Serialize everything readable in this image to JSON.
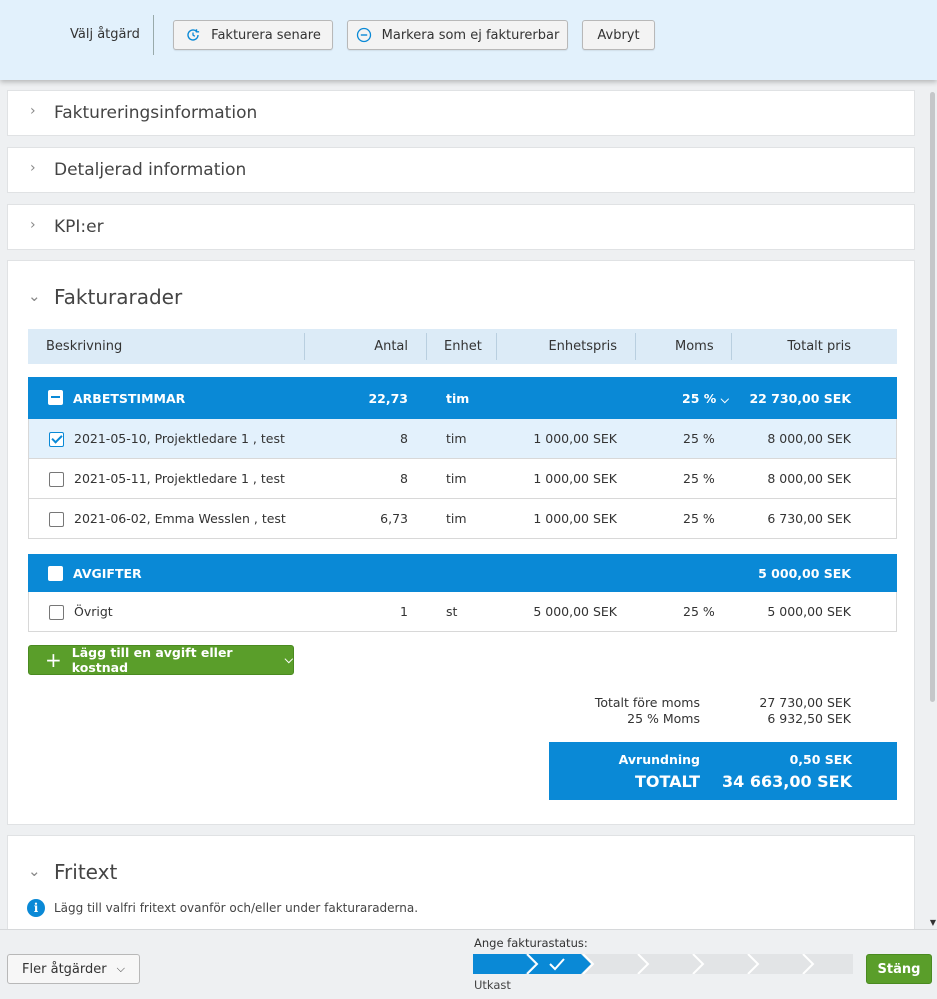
{
  "toolbar": {
    "label": "Välj åtgärd",
    "invoice_later": "Fakturera senare",
    "mark_not_billable": "Markera som ej fakturerbar",
    "cancel": "Avbryt"
  },
  "sections": {
    "billing_info": "Faktureringsinformation",
    "detailed_info": "Detaljerad information",
    "kpi": "KPI:er",
    "invoice_rows": "Fakturarader",
    "freetext": "Fritext"
  },
  "table": {
    "headers": {
      "description": "Beskrivning",
      "quantity": "Antal",
      "unit": "Enhet",
      "unit_price": "Enhetspris",
      "vat": "Moms",
      "total": "Totalt pris"
    },
    "groups": [
      {
        "name": "ARBETSTIMMAR",
        "quantity": "22,73",
        "unit": "tim",
        "vat": "25 %",
        "total": "22 730,00 SEK",
        "rows": [
          {
            "description": "2021-05-10, Projektledare 1 , test",
            "quantity": "8",
            "unit": "tim",
            "unit_price": "1 000,00 SEK",
            "vat": "25 %",
            "total": "8 000,00 SEK",
            "checked": true
          },
          {
            "description": "2021-05-11, Projektledare 1 , test",
            "quantity": "8",
            "unit": "tim",
            "unit_price": "1 000,00 SEK",
            "vat": "25 %",
            "total": "8 000,00 SEK",
            "checked": false
          },
          {
            "description": "2021-06-02, Emma Wesslen , test",
            "quantity": "6,73",
            "unit": "tim",
            "unit_price": "1 000,00 SEK",
            "vat": "25 %",
            "total": "6 730,00 SEK",
            "checked": false
          }
        ]
      },
      {
        "name": "AVGIFTER",
        "total": "5 000,00 SEK",
        "rows": [
          {
            "description": "Övrigt",
            "quantity": "1",
            "unit": "st",
            "unit_price": "5 000,00 SEK",
            "vat": "25 %",
            "total": "5 000,00 SEK",
            "checked": false
          }
        ]
      }
    ]
  },
  "add_fee_button": "Lägg till en avgift eller kostnad",
  "summary": {
    "before_vat_label": "Totalt före moms",
    "before_vat_value": "27 730,00 SEK",
    "vat_label": "25 % Moms",
    "vat_value": "6 932,50 SEK",
    "rounding_label": "Avrundning",
    "rounding_value": "0,50 SEK",
    "total_label": "TOTALT",
    "total_value": "34 663,00 SEK"
  },
  "freetext_info": "Lägg till valfri fritext ovanför och/eller under fakturaraderna.",
  "footer": {
    "more_actions": "Fler åtgärder",
    "status_label": "Ange fakturastatus:",
    "status_value": "Utkast",
    "status_steps_total": 7,
    "status_steps_done": 2,
    "close": "Stäng"
  },
  "colors": {
    "accent_blue": "#0a89d6",
    "green": "#5a9e2a",
    "topbar_bg": "#e2f1fc"
  }
}
